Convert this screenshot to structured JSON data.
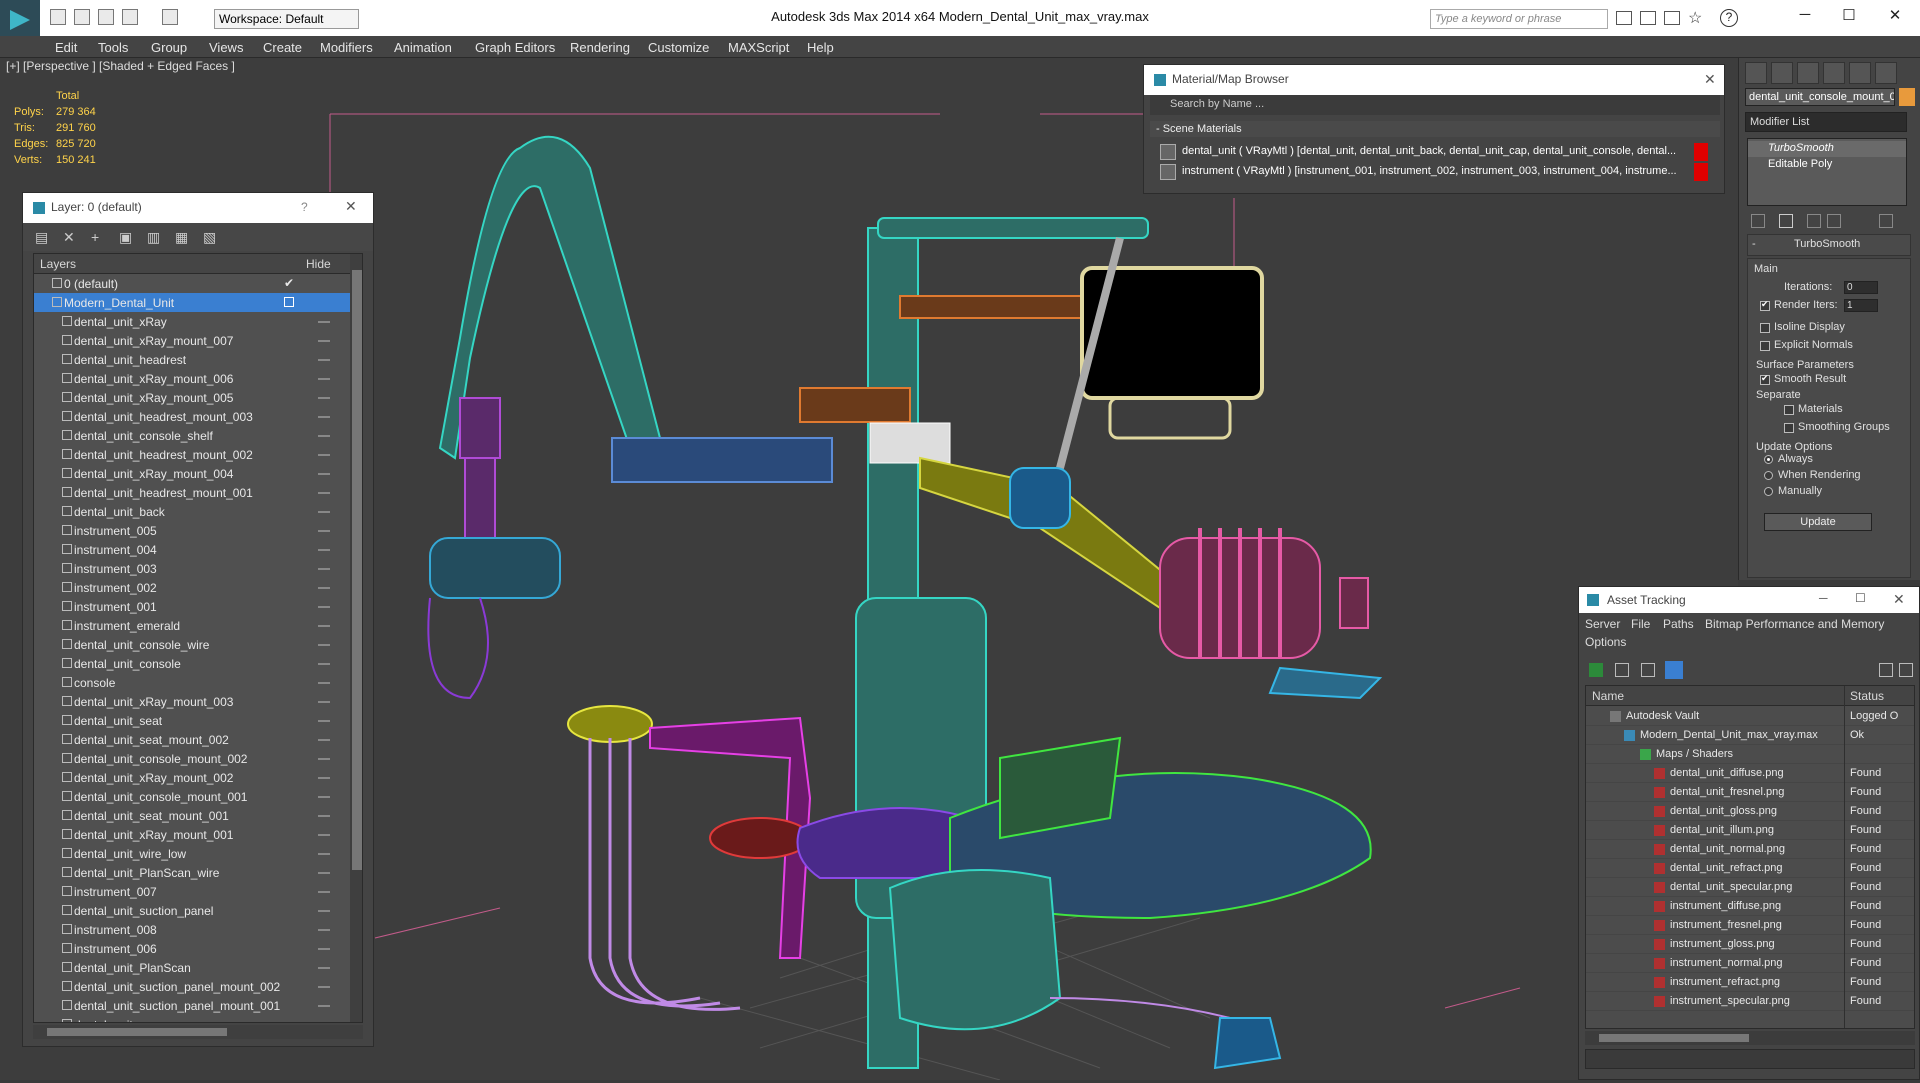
{
  "window": {
    "title": "Autodesk 3ds Max  2014 x64     Modern_Dental_Unit_max_vray.max",
    "workspace": "Workspace: Default",
    "search_placeholder": "Type a keyword or phrase"
  },
  "menu": [
    "Edit",
    "Tools",
    "Group",
    "Views",
    "Create",
    "Modifiers",
    "Animation",
    "Graph Editors",
    "Rendering",
    "Customize",
    "MAXScript",
    "Help"
  ],
  "viewport": {
    "label": "[+] [Perspective ] [Shaded + Edged Faces ]",
    "stats_header": "Total",
    "stats": [
      {
        "label": "Polys:",
        "value": "279 364"
      },
      {
        "label": "Tris:",
        "value": "291 760"
      },
      {
        "label": "Edges:",
        "value": "825 720"
      },
      {
        "label": "Verts:",
        "value": "150 241"
      }
    ]
  },
  "layer_panel": {
    "title": "Layer: 0 (default)",
    "help": "?",
    "col_layers": "Layers",
    "col_hide": "Hide",
    "default_layer": "0 (default)",
    "selected_layer": "Modern_Dental_Unit",
    "items": [
      "dental_unit_xRay",
      "dental_unit_xRay_mount_007",
      "dental_unit_headrest",
      "dental_unit_xRay_mount_006",
      "dental_unit_xRay_mount_005",
      "dental_unit_headrest_mount_003",
      "dental_unit_console_shelf",
      "dental_unit_headrest_mount_002",
      "dental_unit_xRay_mount_004",
      "dental_unit_headrest_mount_001",
      "dental_unit_back",
      "instrument_005",
      "instrument_004",
      "instrument_003",
      "instrument_002",
      "instrument_001",
      "instrument_emerald",
      "dental_unit_console_wire",
      "dental_unit_console",
      "console",
      "dental_unit_xRay_mount_003",
      "dental_unit_seat",
      "dental_unit_seat_mount_002",
      "dental_unit_console_mount_002",
      "dental_unit_xRay_mount_002",
      "dental_unit_console_mount_001",
      "dental_unit_seat_mount_001",
      "dental_unit_xRay_mount_001",
      "dental_unit_wire_low",
      "dental_unit_PlanScan_wire",
      "instrument_007",
      "dental_unit_suction_panel",
      "instrument_008",
      "instrument_006",
      "dental_unit_PlanScan",
      "dental_unit_suction_panel_mount_002",
      "dental_unit_suction_panel_mount_001",
      "dental_unit"
    ]
  },
  "material_browser": {
    "title": "Material/Map Browser",
    "search": "Search by Name ...",
    "section": "- Scene Materials",
    "materials": [
      "dental_unit  ( VRayMtl ) [dental_unit, dental_unit_back, dental_unit_cap, dental_unit_console, dental...",
      "instrument  ( VRayMtl ) [instrument_001, instrument_002, instrument_003, instrument_004, instrume..."
    ]
  },
  "command_panel": {
    "object_name": "dental_unit_console_mount_0",
    "object_color": "#e89a3c",
    "modifier_list": "Modifier List",
    "stack": [
      "TurboSmooth",
      "Editable Poly"
    ],
    "rollout_title": "TurboSmooth",
    "main_label": "Main",
    "iterations_label": "Iterations:",
    "iterations_value": "0",
    "render_iters_label": "Render Iters:",
    "render_iters_value": "1",
    "isoline": "Isoline Display",
    "explicit_normals": "Explicit Normals",
    "surface_params": "Surface Parameters",
    "smooth_result": "Smooth Result",
    "separate": "Separate",
    "materials": "Materials",
    "smoothing_groups": "Smoothing Groups",
    "update_options": "Update Options",
    "always": "Always",
    "when_rendering": "When Rendering",
    "manually": "Manually",
    "update_btn": "Update"
  },
  "asset_tracking": {
    "title": "Asset Tracking",
    "menu": [
      "Server",
      "File",
      "Paths",
      "Bitmap Performance and Memory",
      "Options"
    ],
    "col_name": "Name",
    "col_status": "Status",
    "rows": [
      {
        "name": "Autodesk Vault",
        "status": "Logged O"
      },
      {
        "name": "Modern_Dental_Unit_max_vray.max",
        "status": "Ok"
      },
      {
        "name": "Maps / Shaders",
        "status": ""
      },
      {
        "name": "dental_unit_diffuse.png",
        "status": "Found"
      },
      {
        "name": "dental_unit_fresnel.png",
        "status": "Found"
      },
      {
        "name": "dental_unit_gloss.png",
        "status": "Found"
      },
      {
        "name": "dental_unit_illum.png",
        "status": "Found"
      },
      {
        "name": "dental_unit_normal.png",
        "status": "Found"
      },
      {
        "name": "dental_unit_refract.png",
        "status": "Found"
      },
      {
        "name": "dental_unit_specular.png",
        "status": "Found"
      },
      {
        "name": "instrument_diffuse.png",
        "status": "Found"
      },
      {
        "name": "instrument_fresnel.png",
        "status": "Found"
      },
      {
        "name": "instrument_gloss.png",
        "status": "Found"
      },
      {
        "name": "instrument_normal.png",
        "status": "Found"
      },
      {
        "name": "instrument_refract.png",
        "status": "Found"
      },
      {
        "name": "instrument_specular.png",
        "status": "Found"
      }
    ]
  },
  "colors": {
    "accent_selection": "#3a7fd1",
    "teal_wire": "#35d6c4",
    "found_red": "#e00000"
  }
}
